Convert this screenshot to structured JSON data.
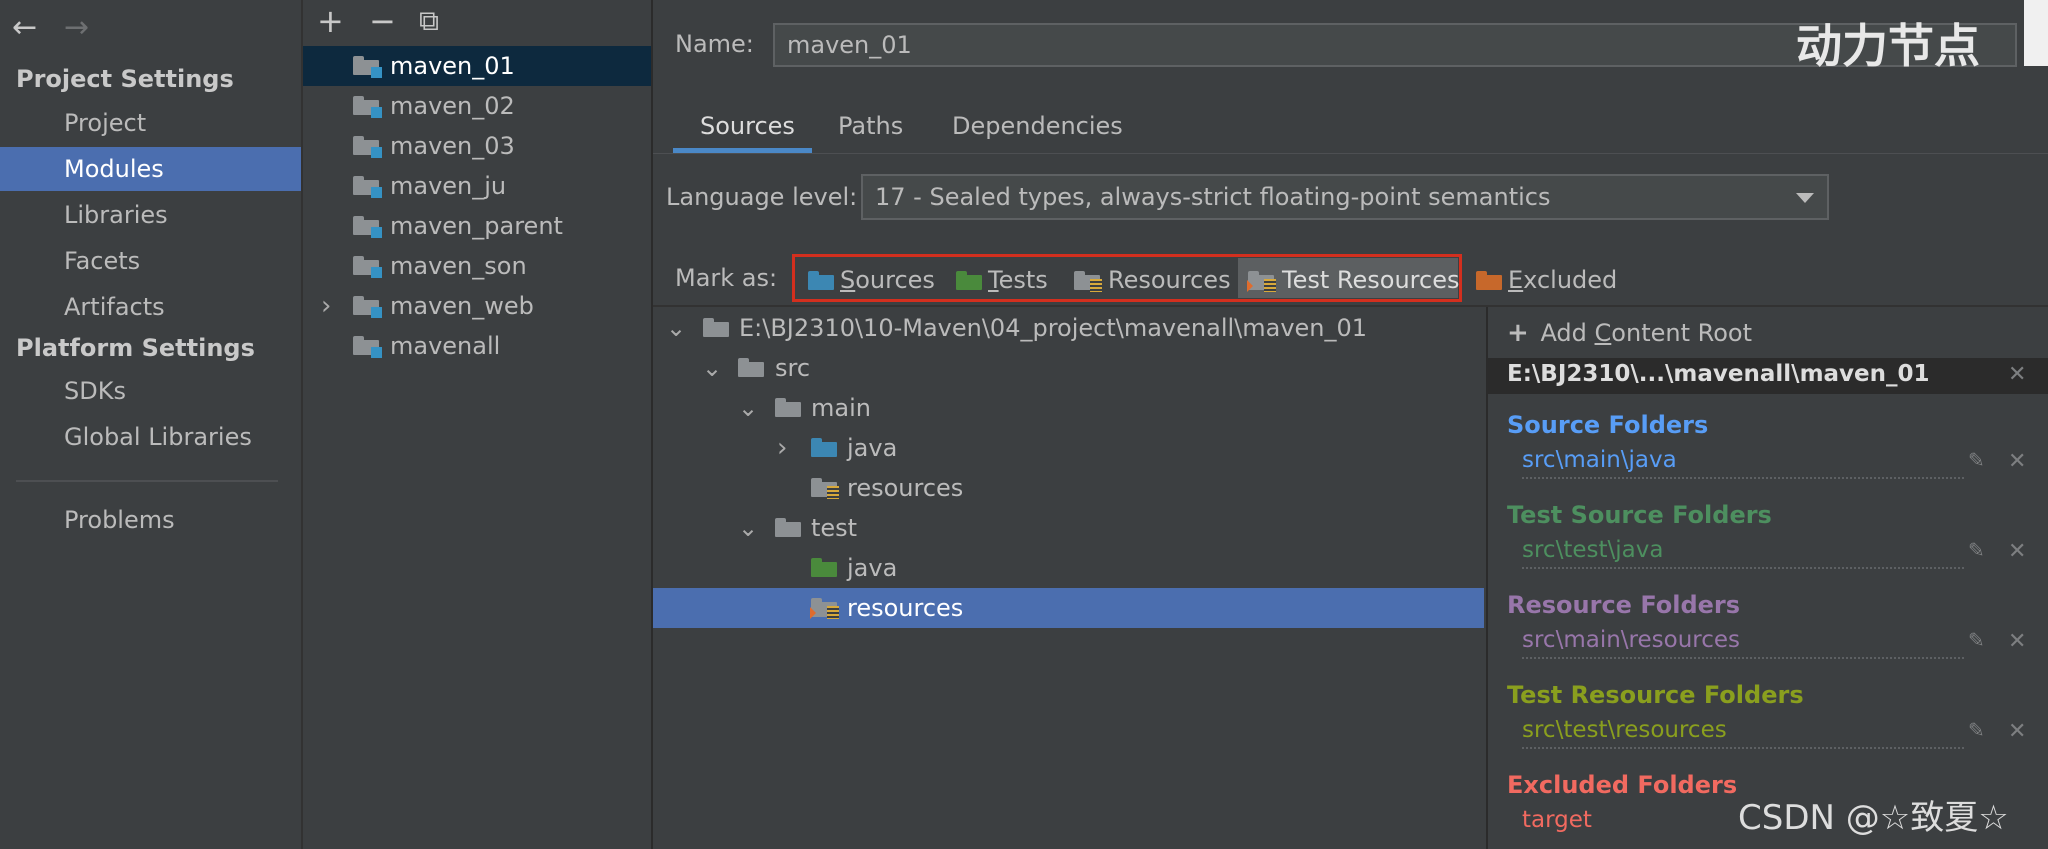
{
  "nav": {
    "back_icon": "←",
    "forward_icon": "→",
    "project_settings_header": "Project Settings",
    "project_items": [
      "Project",
      "Modules",
      "Libraries",
      "Facets",
      "Artifacts"
    ],
    "platform_settings_header": "Platform Settings",
    "platform_items": [
      "SDKs",
      "Global Libraries"
    ],
    "problems": "Problems",
    "selected": "Modules"
  },
  "modules_toolbar": {
    "add_icon": "+",
    "remove_icon": "−",
    "copy_icon": "⧉"
  },
  "modules": [
    "maven_01",
    "maven_02",
    "maven_03",
    "maven_ju",
    "maven_parent",
    "maven_son",
    "maven_web",
    "mavenall"
  ],
  "selected_module": "maven_01",
  "main": {
    "name_label": "Name:",
    "name_value": "maven_01",
    "tabs": [
      "Sources",
      "Paths",
      "Dependencies"
    ],
    "active_tab": "Sources",
    "language_level_label": "Language level:",
    "language_level_value": "17 - Sealed types, always-strict floating-point semantics",
    "mark_as_label": "Mark as:",
    "mark_buttons": [
      {
        "pre": "",
        "ul": "S",
        "post": "ources"
      },
      {
        "pre": "",
        "ul": "T",
        "post": "ests"
      },
      {
        "pre": "",
        "ul": "",
        "post": "Resources"
      },
      {
        "pre": "",
        "ul": "",
        "post": "Test Resources"
      },
      {
        "pre": "",
        "ul": "E",
        "post": "xcluded"
      }
    ]
  },
  "tree": {
    "root": "E:\\BJ2310\\10-Maven\\04_project\\mavenall\\maven_01",
    "src": "src",
    "main": "main",
    "main_java": "java",
    "main_resources": "resources",
    "test": "test",
    "test_java": "java",
    "test_resources": "resources"
  },
  "content_root": {
    "add_label_pre": "Add ",
    "add_label_ul": "C",
    "add_label_post": "ontent Root",
    "root_path": "E:\\BJ2310\\...\\mavenall\\maven_01",
    "sections": [
      {
        "title": "Source Folders",
        "path": "src\\main\\java",
        "color": "#589df6"
      },
      {
        "title": "Test Source Folders",
        "path": "src\\test\\java",
        "color": "#4d8f5f"
      },
      {
        "title": "Resource Folders",
        "path": "src\\main\\resources",
        "color": "#9876aa"
      },
      {
        "title": "Test Resource Folders",
        "path": "src\\test\\resources",
        "color": "#8a9f1e"
      },
      {
        "title": "Excluded Folders",
        "path": "target",
        "color": "#f16a60"
      }
    ]
  },
  "watermarks": {
    "top_right": "动力节点",
    "bottom_right": "CSDN @☆致夏☆"
  }
}
